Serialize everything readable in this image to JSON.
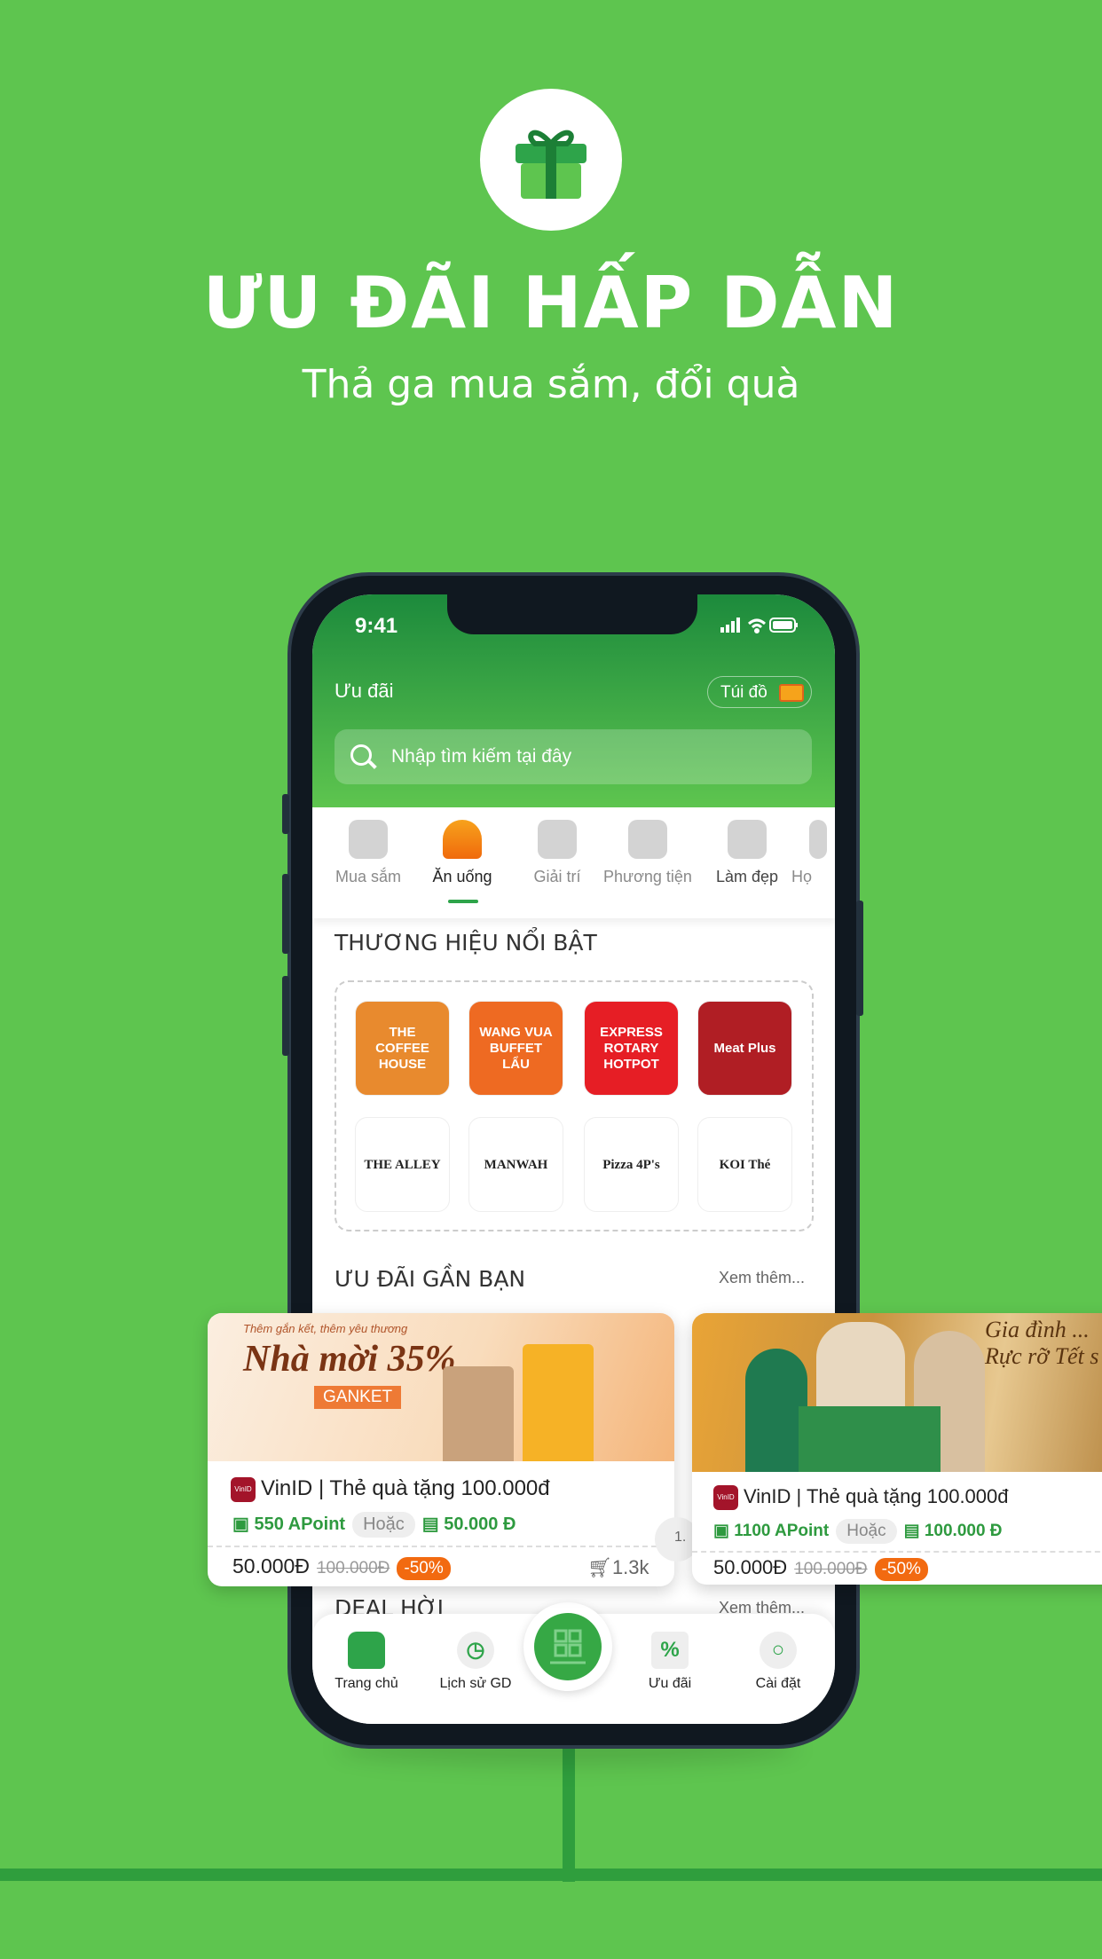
{
  "hero": {
    "title": "ƯU ĐÃI HẤP DẪN",
    "subtitle": "Thả ga mua sắm, đổi quà",
    "icon": "gift-icon"
  },
  "colors": {
    "background": "#5ec54f",
    "accent": "#2ea44a",
    "discount": "#f26a10"
  },
  "status": {
    "time": "9:41"
  },
  "header": {
    "title": "Ưu đãi",
    "bag_label": "Túi đồ",
    "search_placeholder": "Nhập tìm kiếm tại đây"
  },
  "categories": [
    {
      "label": "Mua sắm",
      "icon": "basket-icon"
    },
    {
      "label": "Ăn uống",
      "icon": "food-cloche-icon",
      "active": true
    },
    {
      "label": "Giải trí",
      "icon": "gamepad-icon"
    },
    {
      "label": "Phương tiện",
      "icon": "airplane-icon"
    },
    {
      "label": "Làm đẹp",
      "icon": "beauty-icon"
    },
    {
      "label": "Họ",
      "icon": "education-icon"
    }
  ],
  "brands": {
    "title": "THƯƠNG HIỆU NỔI BẬT",
    "items": [
      {
        "name": "THE COFFEE HOUSE",
        "color": "#e88a2e"
      },
      {
        "name": "WANG VUA BUFFET LẨU",
        "color": "#ee6a22"
      },
      {
        "name": "EXPRESS ROTARY HOTPOT",
        "color": "#e61e25"
      },
      {
        "name": "Meat Plus",
        "color": "#b01e24"
      },
      {
        "name": "THE ALLEY",
        "color": "#ffffff"
      },
      {
        "name": "MANWAH",
        "color": "#ffffff"
      },
      {
        "name": "Pizza 4P's",
        "color": "#ffffff"
      },
      {
        "name": "KOI Thé",
        "color": "#ffffff"
      }
    ]
  },
  "nearby": {
    "title": "ƯU ĐÃI GẦN BẠN",
    "more": "Xem thêm...",
    "cards": [
      {
        "banner": "Nhà mời 35%",
        "banner_tag": "Thêm gắn kết, thêm yêu thương",
        "code": "GANKET",
        "brand": "VinID",
        "name": "| Thẻ quà tặng 100.000đ",
        "points": "550 APoint",
        "or": "Hoặc",
        "cash": "50.000 Đ",
        "price": "50.000Đ",
        "old_price": "100.000Đ",
        "discount": "-50%",
        "sold": "1.3k"
      },
      {
        "banner": "Gia đình ... Rực rỡ Tết s",
        "brand": "VinID",
        "name": "| Thẻ quà tặng 100.000đ",
        "points": "1100 APoint",
        "or": "Hoặc",
        "cash": "100.000 Đ",
        "price": "50.000Đ",
        "old_price": "100.000Đ",
        "discount": "-50%",
        "sold": "1."
      }
    ]
  },
  "deals": {
    "title": "DEAL HỜI",
    "more": "Xem thêm..."
  },
  "nav": [
    {
      "label": "Trang chủ",
      "icon": "home-wallet-icon"
    },
    {
      "label": "Lịch sử GD",
      "icon": "clock-icon"
    },
    {
      "label": "",
      "icon": "qr-scan-icon"
    },
    {
      "label": "Ưu đãi",
      "icon": "percent-icon"
    },
    {
      "label": "Cài đặt",
      "icon": "gear-icon"
    }
  ]
}
